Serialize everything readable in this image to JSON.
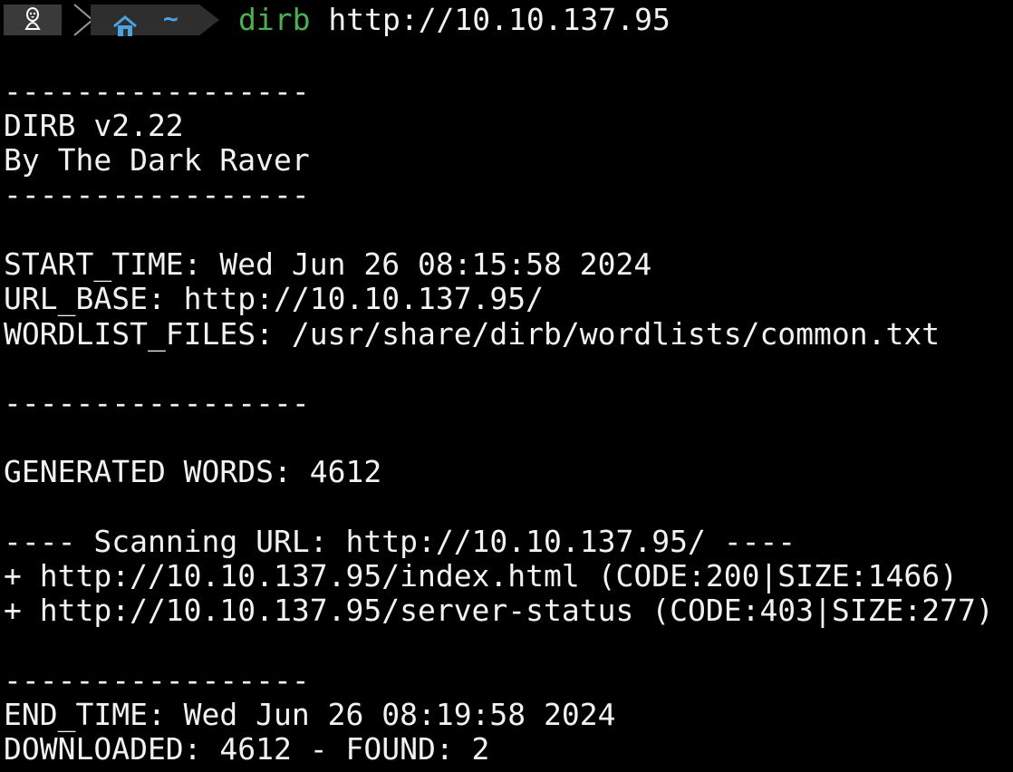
{
  "prompt": {
    "os_icon": "linux-penguin-icon",
    "home_icon": "home-icon",
    "directory": "~",
    "command_name": "dirb",
    "command_args": " http://10.10.137.95",
    "colors": {
      "command": "#4caf50",
      "accent": "#4aa3df",
      "text": "#f2f2f2",
      "background": "#000000"
    }
  },
  "output": {
    "divider_1": "-----------------",
    "banner_version": "DIRB v2.22",
    "banner_author": "By The Dark Raver",
    "divider_2": "-----------------",
    "start_time": "START_TIME: Wed Jun 26 08:15:58 2024",
    "url_base": "URL_BASE: http://10.10.137.95/",
    "wordlist_files": "WORDLIST_FILES: /usr/share/dirb/wordlists/common.txt",
    "divider_3": "-----------------",
    "generated_words": "GENERATED WORDS: 4612",
    "scanning_header": "---- Scanning URL: http://10.10.137.95/ ----",
    "result_1": "+ http://10.10.137.95/index.html (CODE:200|SIZE:1466)",
    "result_2": "+ http://10.10.137.95/server-status (CODE:403|SIZE:277)",
    "divider_4": "-----------------",
    "end_time": "END_TIME: Wed Jun 26 08:19:58 2024",
    "summary": "DOWNLOADED: 4612 - FOUND: 2"
  }
}
